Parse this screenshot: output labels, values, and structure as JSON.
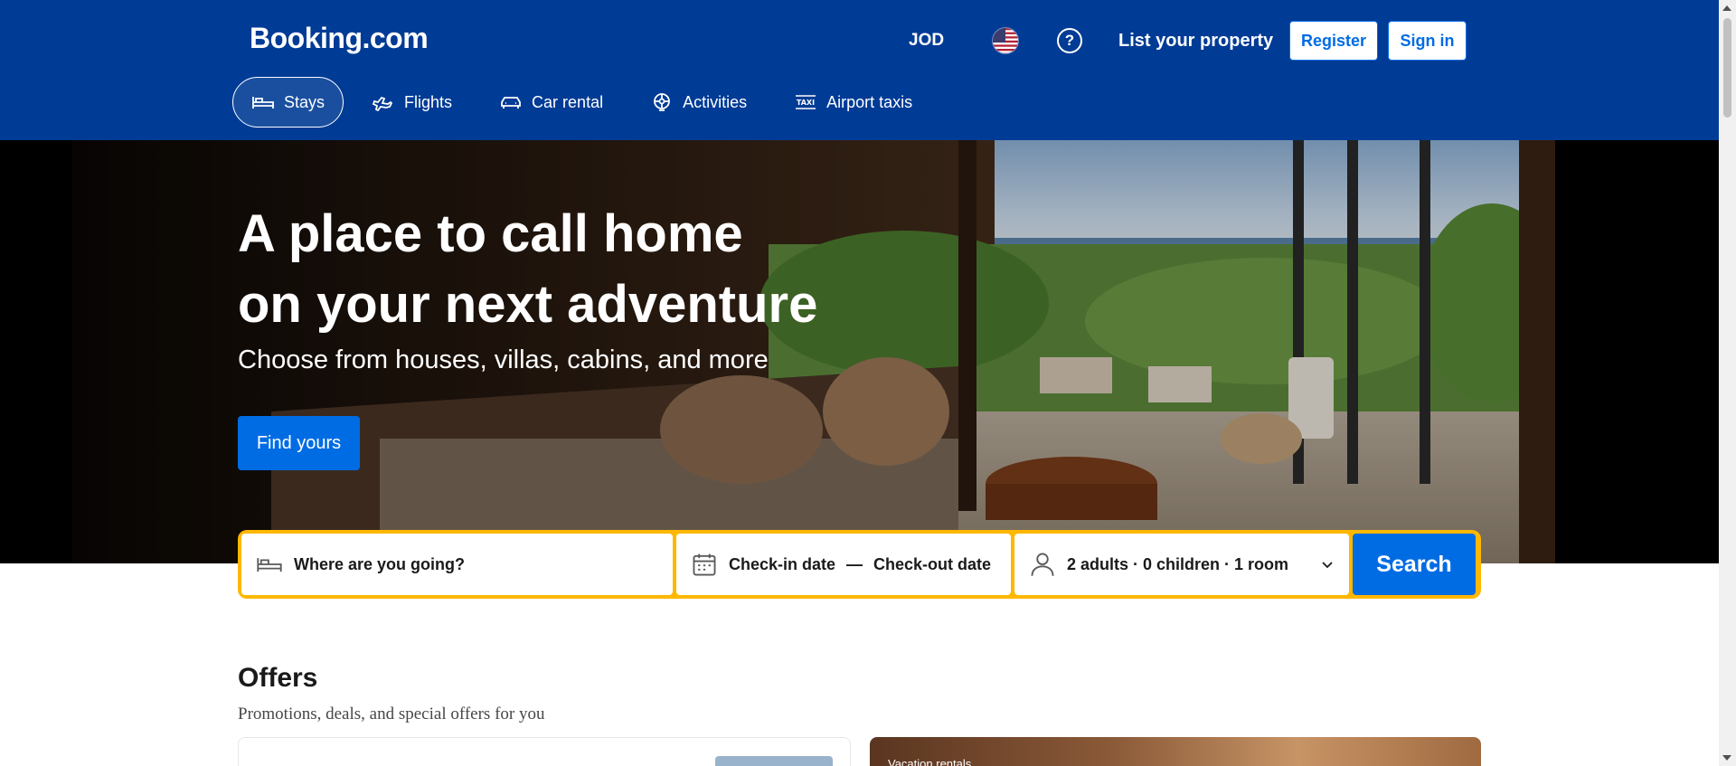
{
  "header": {
    "logo": "Booking.com",
    "currency": "JOD",
    "flag_icon": "us-flag-icon",
    "help_icon": "question-circle-icon",
    "list_property": "List your property",
    "register_label": "Register",
    "signin_label": "Sign in",
    "brand_color": "#003b95",
    "accent_color": "#006ce4"
  },
  "nav": {
    "items": [
      {
        "label": "Stays",
        "icon": "bed-icon",
        "active": true
      },
      {
        "label": "Flights",
        "icon": "plane-icon",
        "active": false
      },
      {
        "label": "Car rental",
        "icon": "car-icon",
        "active": false
      },
      {
        "label": "Activities",
        "icon": "attraction-icon",
        "active": false
      },
      {
        "label": "Airport taxis",
        "icon": "taxi-icon",
        "active": false
      }
    ]
  },
  "hero": {
    "title_line1": "A place to call home",
    "title_line2": "on your next adventure",
    "subtitle": "Choose from houses, villas, cabins, and more",
    "cta_label": "Find yours"
  },
  "search": {
    "destination_placeholder": "Where are you going?",
    "checkin": "Check-in date",
    "separator": "—",
    "checkout": "Check-out date",
    "guests": "2 adults · 0 children · 1 room",
    "button_label": "Search",
    "border_color": "#ffb700"
  },
  "offers": {
    "title": "Offers",
    "subtitle": "Promotions, deals, and special offers for you",
    "card2_label": "Vacation rentals"
  }
}
